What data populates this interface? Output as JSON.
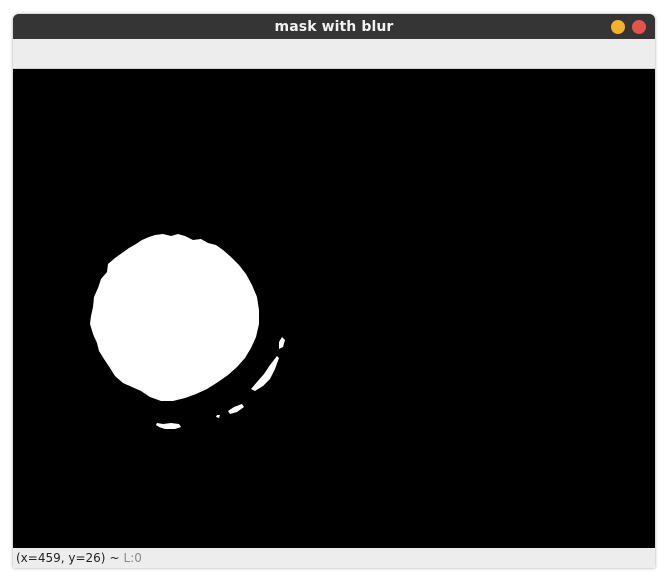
{
  "window": {
    "title": "mask with blur"
  },
  "titlebar_buttons": {
    "minimize_color": "#f4b22a",
    "close_color": "#e35349"
  },
  "image": {
    "description_icon": "binary-mask-image"
  },
  "status": {
    "coords": "(x=459, y=26)",
    "separator": "~",
    "layer": "L:0"
  }
}
